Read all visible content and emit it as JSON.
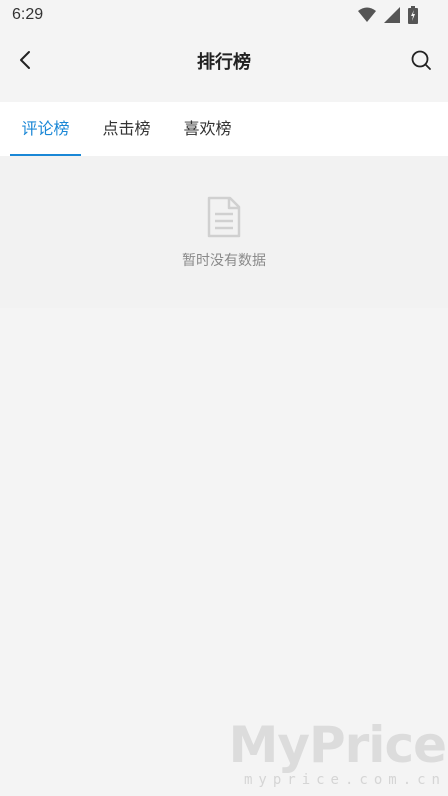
{
  "status_bar": {
    "time": "6:29",
    "icons": [
      "wifi-icon",
      "cell-signal-icon",
      "battery-icon"
    ]
  },
  "header": {
    "title": "排行榜",
    "back_icon": "chevron-left-icon",
    "search_icon": "search-icon"
  },
  "tabs": [
    {
      "label": "评论榜",
      "active": true
    },
    {
      "label": "点击榜",
      "active": false
    },
    {
      "label": "喜欢榜",
      "active": false
    }
  ],
  "empty_state": {
    "icon": "document-icon",
    "message": "暂时没有数据"
  },
  "watermark": {
    "logo": "MyPrice",
    "url": "myprice.com.cn"
  },
  "colors": {
    "accent": "#1a87d6",
    "background": "#f4f4f4",
    "tab_background": "#ffffff",
    "muted_text": "#8a8a8a"
  }
}
